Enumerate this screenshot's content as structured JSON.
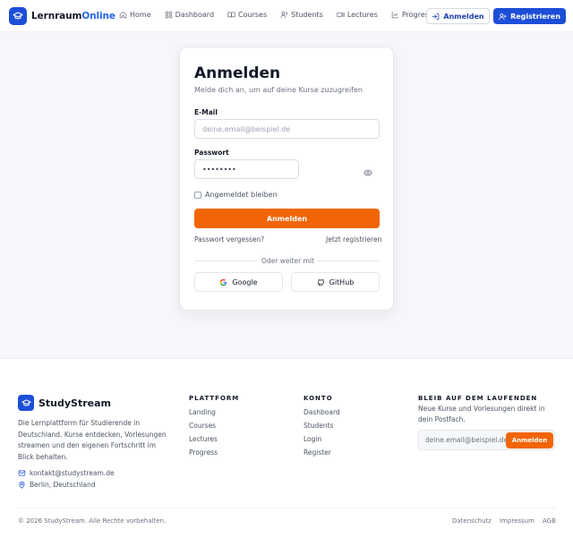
{
  "nav": {
    "brand_part1": "Lernraum",
    "brand_part2": "Online",
    "links": [
      {
        "label": "Home",
        "icon": "home-icon"
      },
      {
        "label": "Dashboard",
        "icon": "dashboard-icon"
      },
      {
        "label": "Courses",
        "icon": "book-icon"
      },
      {
        "label": "Students",
        "icon": "users-icon"
      },
      {
        "label": "Lectures",
        "icon": "video-icon"
      },
      {
        "label": "Progress",
        "icon": "chart-icon"
      }
    ],
    "login_label": "Anmelden",
    "register_label": "Registrieren"
  },
  "login": {
    "title": "Anmelden",
    "subtitle": "Melde dich an, um auf deine Kurse zuzugreifen",
    "email_label": "E-Mail",
    "email_placeholder": "deine.email@beispiel.de",
    "password_label": "Passwort",
    "password_value": "••••••••",
    "remember_label": "Angemeldet bleiben",
    "submit_label": "Anmelden",
    "forgot_label": "Passwort vergessen?",
    "register_label": "Jetzt registrieren",
    "divider_label": "Oder weiter mit",
    "google_label": "Google",
    "github_label": "GitHub"
  },
  "footer": {
    "brand": "StudyStream",
    "description": "Die Lernplattform für Studierende in Deutschland. Kurse entdecken, Vorlesungen streamen und den eigenen Fortschritt im Blick behalten.",
    "email": "kontakt@studystream.de",
    "location": "Berlin, Deutschland",
    "plattform": {
      "title": "PLATTFORM",
      "links": [
        "Landing",
        "Courses",
        "Lectures",
        "Progress"
      ]
    },
    "konto": {
      "title": "KONTO",
      "links": [
        "Dashboard",
        "Students",
        "Login",
        "Register"
      ]
    },
    "newsletter": {
      "title": "BLEIB AUF DEM LAUFENDEN",
      "text": "Neue Kurse und Vorlesungen direkt in dein Postfach.",
      "placeholder": "deine.email@beispiel.de",
      "button": "Anmelden"
    },
    "copyright": "© 2026 StudyStream. Alle Rechte vorbehalten.",
    "legal": [
      "Datenschutz",
      "Impressum",
      "AGB"
    ]
  },
  "colors": {
    "primary": "#1d4ed8",
    "accent": "#f26507"
  }
}
